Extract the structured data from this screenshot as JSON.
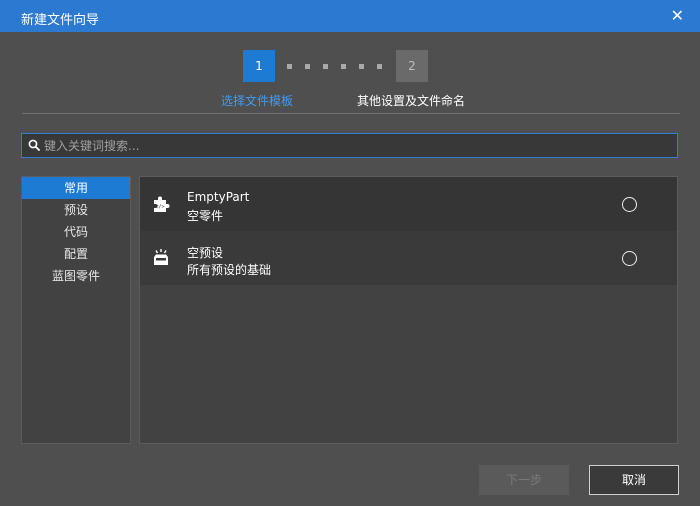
{
  "window": {
    "title": "新建文件向导"
  },
  "steps": [
    {
      "number": "1",
      "label": "选择文件模板"
    },
    {
      "number": "2",
      "label": "其他设置及文件命名"
    }
  ],
  "search": {
    "placeholder": "键入关键词搜索..."
  },
  "categories": [
    {
      "label": "常用"
    },
    {
      "label": "预设"
    },
    {
      "label": "代码"
    },
    {
      "label": "配置"
    },
    {
      "label": "蓝图零件"
    }
  ],
  "templates": [
    {
      "name": "EmptyPart",
      "description": "空零件",
      "icon": "puzzle-code-icon"
    },
    {
      "name": "空预设",
      "description": "所有预设的基础",
      "icon": "tray-sparkle-icon"
    }
  ],
  "buttons": {
    "next": "下一步",
    "cancel": "取消"
  },
  "colors": {
    "accent": "#1e7bd3",
    "titlebar": "#2b79d0",
    "step_label_active": "#3f9cf3"
  }
}
